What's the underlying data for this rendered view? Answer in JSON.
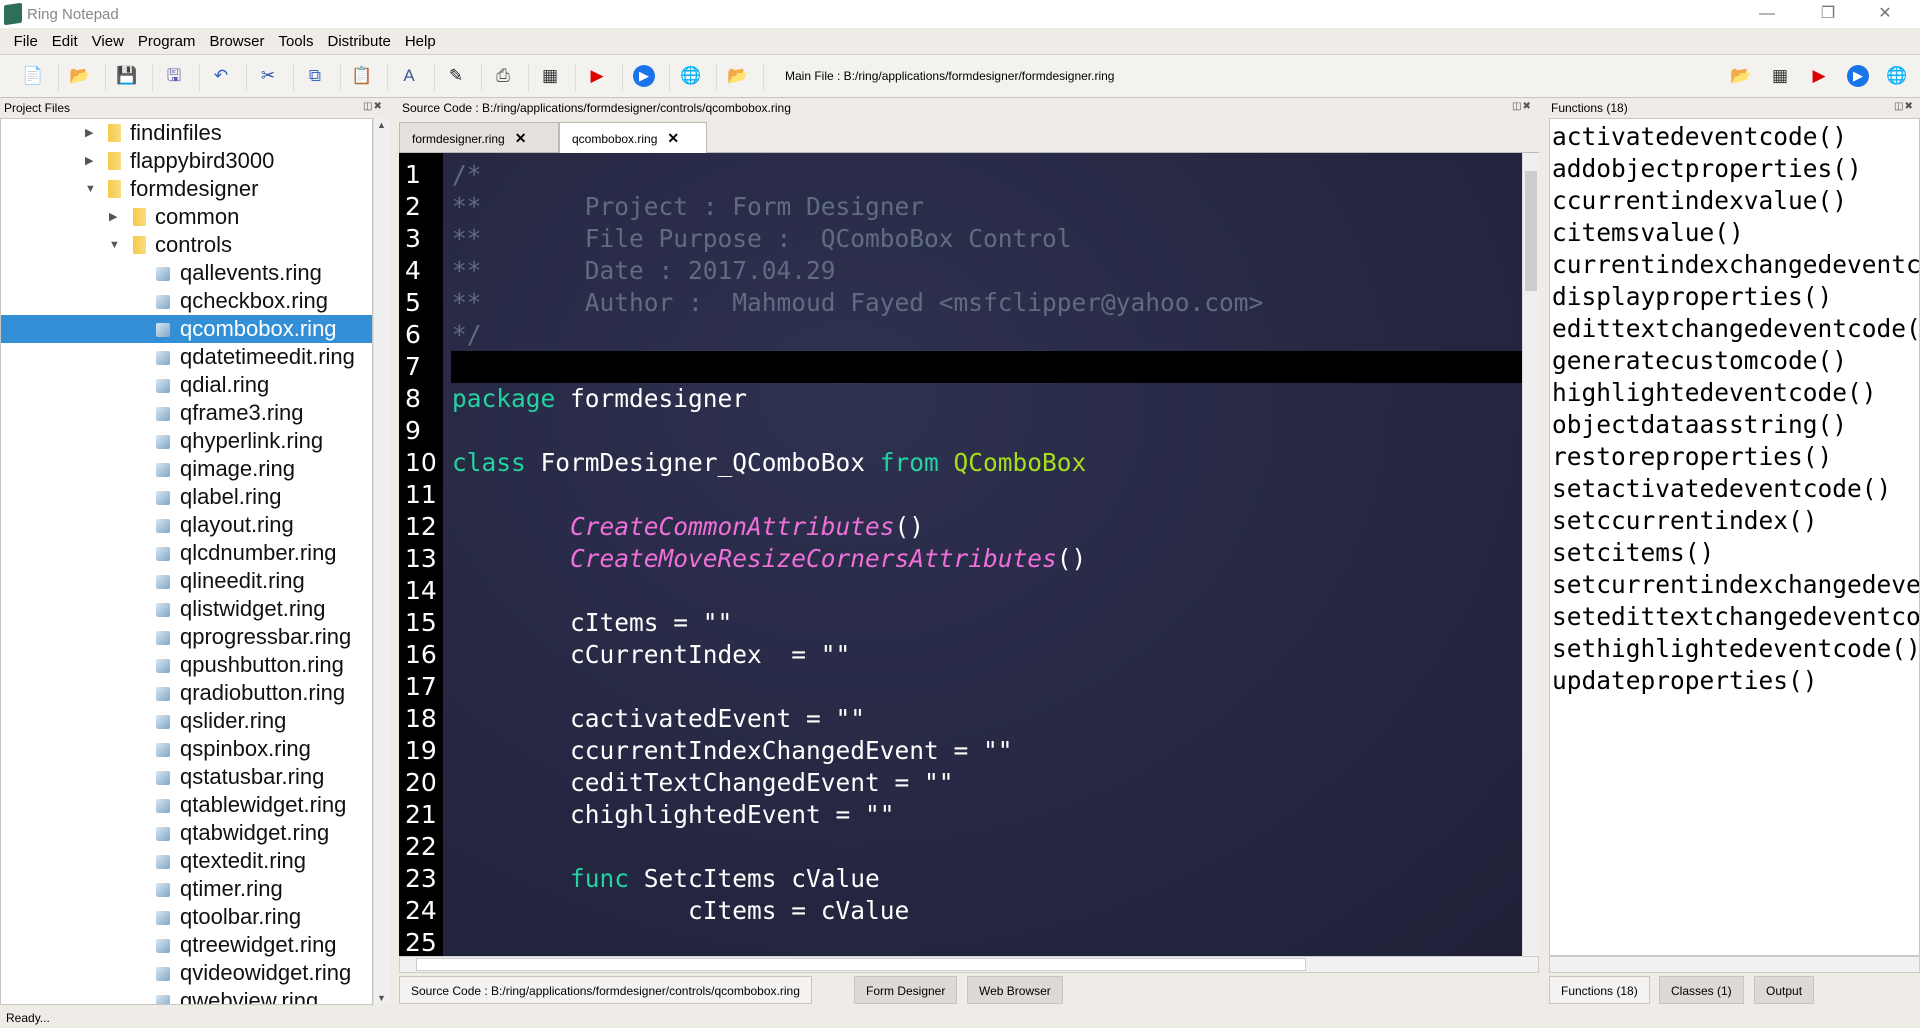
{
  "window": {
    "title": "Ring Notepad",
    "minimize": "—",
    "restore": "❐",
    "close": "✕"
  },
  "menu": [
    "File",
    "Edit",
    "View",
    "Program",
    "Browser",
    "Tools",
    "Distribute",
    "Help"
  ],
  "toolbar": {
    "main_file_label": "Main File :  B:/ring/applications/formdesigner/formdesigner.ring",
    "icons": [
      "new-file",
      "open-folder",
      "save",
      "save-as",
      "undo",
      "cut",
      "copy",
      "paste",
      "font",
      "highlighter",
      "print",
      "debug",
      "run-gui",
      "run",
      "web-browser",
      "set-main-file"
    ],
    "right_icons": [
      "open-folder",
      "debug",
      "run-gui",
      "run",
      "web-browser"
    ]
  },
  "project": {
    "title": "Project Files",
    "items": [
      {
        "label": "findinfiles",
        "type": "folder",
        "level": 1,
        "arrow": "right"
      },
      {
        "label": "flappybird3000",
        "type": "folder",
        "level": 1,
        "arrow": "right"
      },
      {
        "label": "formdesigner",
        "type": "folder",
        "level": 1,
        "arrow": "down"
      },
      {
        "label": "common",
        "type": "folder",
        "level": 2,
        "arrow": "right"
      },
      {
        "label": "controls",
        "type": "folder",
        "level": 2,
        "arrow": "down"
      },
      {
        "label": "qallevents.ring",
        "type": "file",
        "level": 3
      },
      {
        "label": "qcheckbox.ring",
        "type": "file",
        "level": 3
      },
      {
        "label": "qcombobox.ring",
        "type": "file",
        "level": 3,
        "selected": true
      },
      {
        "label": "qdatetimeedit.ring",
        "type": "file",
        "level": 3
      },
      {
        "label": "qdial.ring",
        "type": "file",
        "level": 3
      },
      {
        "label": "qframe3.ring",
        "type": "file",
        "level": 3
      },
      {
        "label": "qhyperlink.ring",
        "type": "file",
        "level": 3
      },
      {
        "label": "qimage.ring",
        "type": "file",
        "level": 3
      },
      {
        "label": "qlabel.ring",
        "type": "file",
        "level": 3
      },
      {
        "label": "qlayout.ring",
        "type": "file",
        "level": 3
      },
      {
        "label": "qlcdnumber.ring",
        "type": "file",
        "level": 3
      },
      {
        "label": "qlineedit.ring",
        "type": "file",
        "level": 3
      },
      {
        "label": "qlistwidget.ring",
        "type": "file",
        "level": 3
      },
      {
        "label": "qprogressbar.ring",
        "type": "file",
        "level": 3
      },
      {
        "label": "qpushbutton.ring",
        "type": "file",
        "level": 3
      },
      {
        "label": "qradiobutton.ring",
        "type": "file",
        "level": 3
      },
      {
        "label": "qslider.ring",
        "type": "file",
        "level": 3
      },
      {
        "label": "qspinbox.ring",
        "type": "file",
        "level": 3
      },
      {
        "label": "qstatusbar.ring",
        "type": "file",
        "level": 3
      },
      {
        "label": "qtablewidget.ring",
        "type": "file",
        "level": 3
      },
      {
        "label": "qtabwidget.ring",
        "type": "file",
        "level": 3
      },
      {
        "label": "qtextedit.ring",
        "type": "file",
        "level": 3
      },
      {
        "label": "qtimer.ring",
        "type": "file",
        "level": 3
      },
      {
        "label": "qtoolbar.ring",
        "type": "file",
        "level": 3
      },
      {
        "label": "qtreewidget.ring",
        "type": "file",
        "level": 3
      },
      {
        "label": "qvideowidget.ring",
        "type": "file",
        "level": 3
      },
      {
        "label": "qwebview.ring",
        "type": "file",
        "level": 3
      }
    ]
  },
  "source": {
    "title": "Source Code : B:/ring/applications/formdesigner/controls/qcombobox.ring",
    "tabs": [
      {
        "label": "formdesigner.ring",
        "close": "✕"
      },
      {
        "label": "qcombobox.ring",
        "close": "✕",
        "active": true
      }
    ],
    "current_line": 7,
    "lines": [
      [
        [
          "cm",
          "/*"
        ]
      ],
      [
        [
          "cm",
          "**       Project : Form Designer"
        ]
      ],
      [
        [
          "cm",
          "**       File Purpose :  QComboBox Control"
        ]
      ],
      [
        [
          "cm",
          "**       Date : 2017.04.29"
        ]
      ],
      [
        [
          "cm",
          "**       Author :  Mahmoud Fayed <msfclipper@yahoo.com>"
        ]
      ],
      [
        [
          "cm",
          "*/"
        ]
      ],
      [],
      [
        [
          "kw",
          "package"
        ],
        [
          "id",
          " formdesigner"
        ]
      ],
      [],
      [
        [
          "kw",
          "class"
        ],
        [
          "id",
          " FormDesigner_QComboBox "
        ],
        [
          "kw",
          "from"
        ],
        [
          "cls",
          " QComboBox"
        ]
      ],
      [],
      [
        [
          "id",
          "        "
        ],
        [
          "fn",
          "CreateCommonAttributes"
        ],
        [
          "id",
          "()"
        ]
      ],
      [
        [
          "id",
          "        "
        ],
        [
          "fn",
          "CreateMoveResizeCornersAttributes"
        ],
        [
          "id",
          "()"
        ]
      ],
      [],
      [
        [
          "id",
          "        cItems = \"\""
        ]
      ],
      [
        [
          "id",
          "        cCurrentIndex  = \"\""
        ]
      ],
      [],
      [
        [
          "id",
          "        cactivatedEvent = \"\""
        ]
      ],
      [
        [
          "id",
          "        ccurrentIndexChangedEvent = \"\""
        ]
      ],
      [
        [
          "id",
          "        ceditTextChangedEvent = \"\""
        ]
      ],
      [
        [
          "id",
          "        chighlightedEvent = \"\""
        ]
      ],
      [],
      [
        [
          "id",
          "        "
        ],
        [
          "kw",
          "func"
        ],
        [
          "id",
          " SetcItems cValue"
        ]
      ],
      [
        [
          "id",
          "                cItems = cValue"
        ]
      ],
      []
    ]
  },
  "bottom_tabs": [
    "Source Code : B:/ring/applications/formdesigner/controls/qcombobox.ring",
    "Form Designer",
    "Web Browser"
  ],
  "functions": {
    "title": "Functions (18)",
    "items": [
      "activatedeventcode()",
      "addobjectproperties()",
      "ccurrentindexvalue()",
      "citemsvalue()",
      "currentindexchangedeventcode()",
      "displayproperties()",
      "edittextchangedeventcode()",
      "generatecustomcode()",
      "highlightedeventcode()",
      "objectdataasstring()",
      "restoreproperties()",
      "setactivatedeventcode()",
      "setccurrentindex()",
      "setcitems()",
      "setcurrentindexchangedeventcode()",
      "setedittextchangedeventcode()",
      "sethighlightedeventcode()",
      "updateproperties()"
    ]
  },
  "right_tabs": [
    "Functions (18)",
    "Classes (1)",
    "Output"
  ],
  "status": "Ready...",
  "colors": {
    "editor_bg": "#25273f",
    "comment": "#5f6d7f",
    "keyword": "#23d3a0",
    "class": "#a8dd1c",
    "function": "#f06fd9",
    "selection": "#3390d6"
  }
}
